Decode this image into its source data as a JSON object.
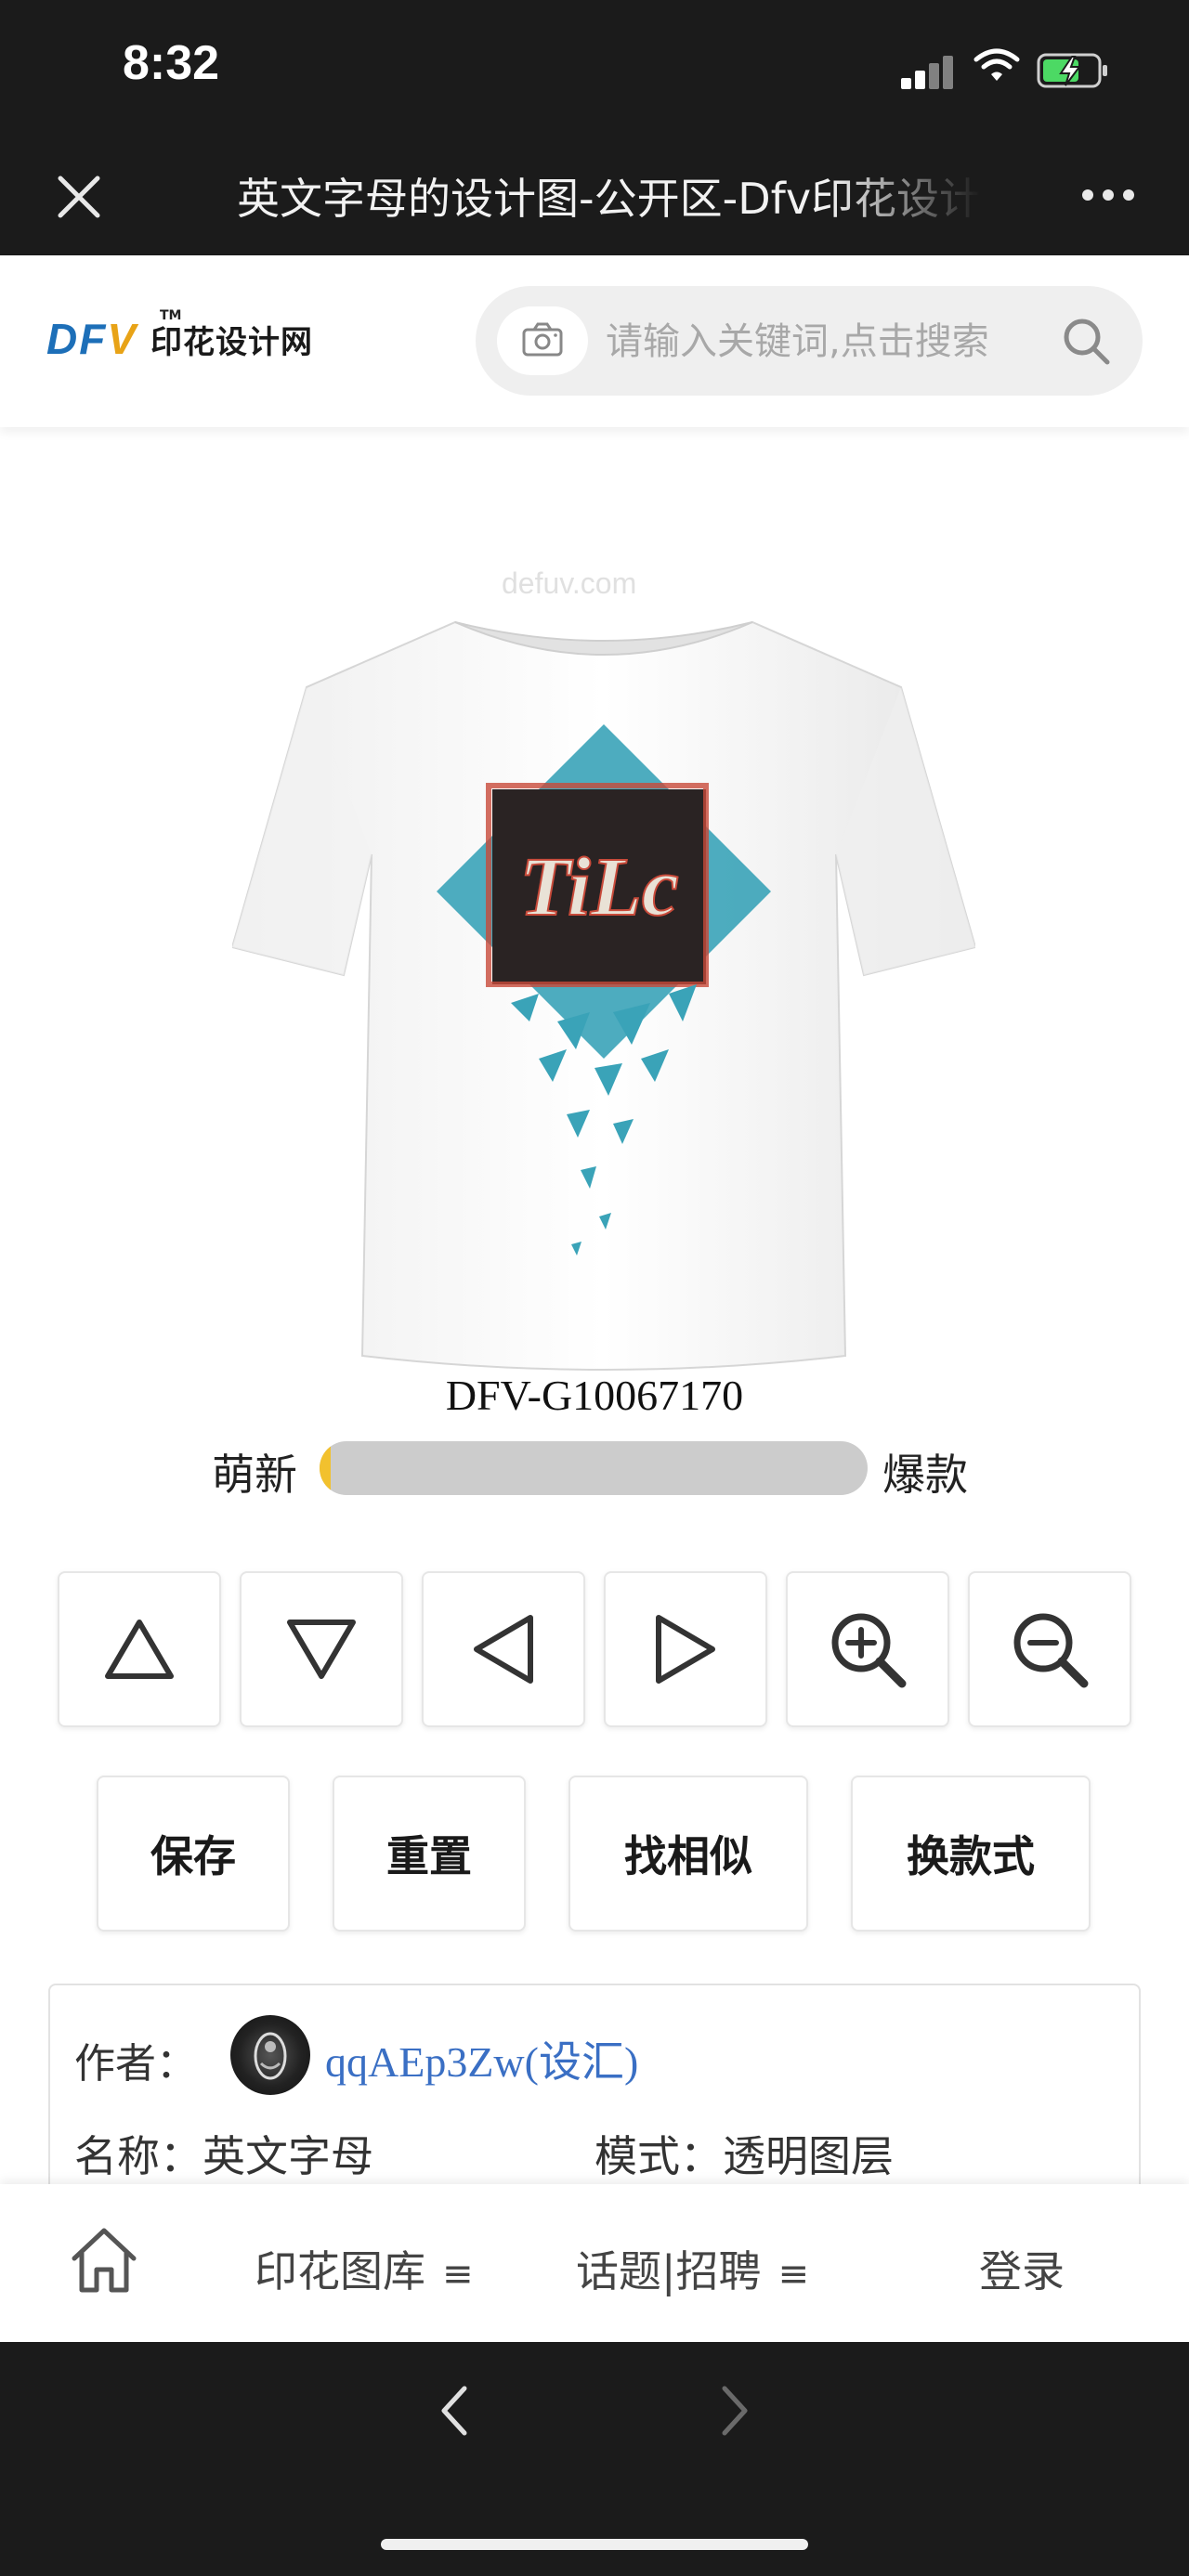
{
  "status_bar": {
    "time": "8:32"
  },
  "title_bar": {
    "title": "英文字母的设计图-公开区-Dfv印花设计网"
  },
  "header": {
    "logo_mark_d": "D",
    "logo_mark_f": "F",
    "logo_mark_v": "V",
    "logo_tm": "TM",
    "logo_text": "印花设计网",
    "search_placeholder": "请输入关键词,点击搜索"
  },
  "product": {
    "watermark": "defuv.com",
    "code": "DFV-G10067170",
    "popularity": {
      "left_label": "萌新",
      "right_label": "爆款",
      "level_fraction": 0.02,
      "fill_color": "#f2c12e",
      "track_color": "#cccccc"
    }
  },
  "controls": {
    "icons": [
      "triangle-up-icon",
      "triangle-down-icon",
      "triangle-left-icon",
      "triangle-right-icon",
      "zoom-in-icon",
      "zoom-out-icon"
    ],
    "actions": [
      "保存",
      "重置",
      "找相似",
      "换款式"
    ]
  },
  "info": {
    "author_label": "作者：",
    "author_name": "qqAEp3Zw(设汇)",
    "name_field": "名称：英文字母",
    "mode_field": "模式：透明图层"
  },
  "bottom_nav": {
    "items": [
      "印花图库",
      "话题|招聘",
      "登录"
    ],
    "menu_glyph": "≡"
  },
  "colors": {
    "bar_bg": "#1b1b1b",
    "link": "#3a6fc4",
    "logo_blue": "#1d6fb8",
    "logo_orange": "#e8a317"
  }
}
